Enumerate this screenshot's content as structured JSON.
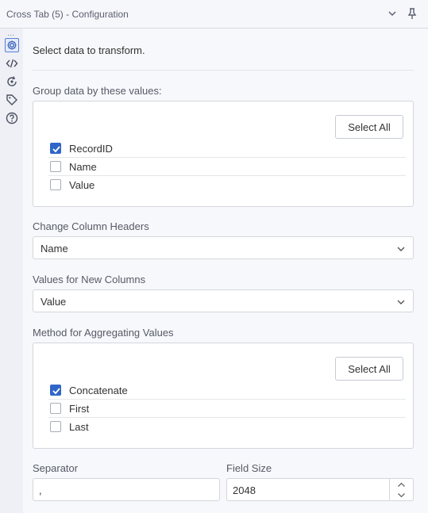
{
  "window": {
    "title": "Cross Tab (5) - Configuration",
    "collapse_icon": "chevron-down-icon",
    "pin_icon": "pin-icon"
  },
  "sidebar": {
    "overflow": "...",
    "icons": [
      "gear-icon",
      "code-icon",
      "rotate-icon",
      "tag-icon",
      "help-icon"
    ]
  },
  "main": {
    "intro": "Select data to transform.",
    "group_by": {
      "label": "Group data by these values:",
      "select_all": "Select All",
      "items": [
        {
          "label": "RecordID",
          "checked": true
        },
        {
          "label": "Name",
          "checked": false
        },
        {
          "label": "Value",
          "checked": false
        }
      ]
    },
    "column_headers": {
      "label": "Change Column Headers",
      "value": "Name"
    },
    "new_columns": {
      "label": "Values for New Columns",
      "value": "Value"
    },
    "aggregation": {
      "label": "Method for Aggregating Values",
      "select_all": "Select All",
      "items": [
        {
          "label": "Concatenate",
          "checked": true
        },
        {
          "label": "First",
          "checked": false
        },
        {
          "label": "Last",
          "checked": false
        }
      ]
    },
    "separator": {
      "label": "Separator",
      "value": ","
    },
    "field_size": {
      "label": "Field Size",
      "value": "2048"
    }
  },
  "colors": {
    "accent": "#2f66c8",
    "active_icon_border": "#5a7fd6"
  }
}
